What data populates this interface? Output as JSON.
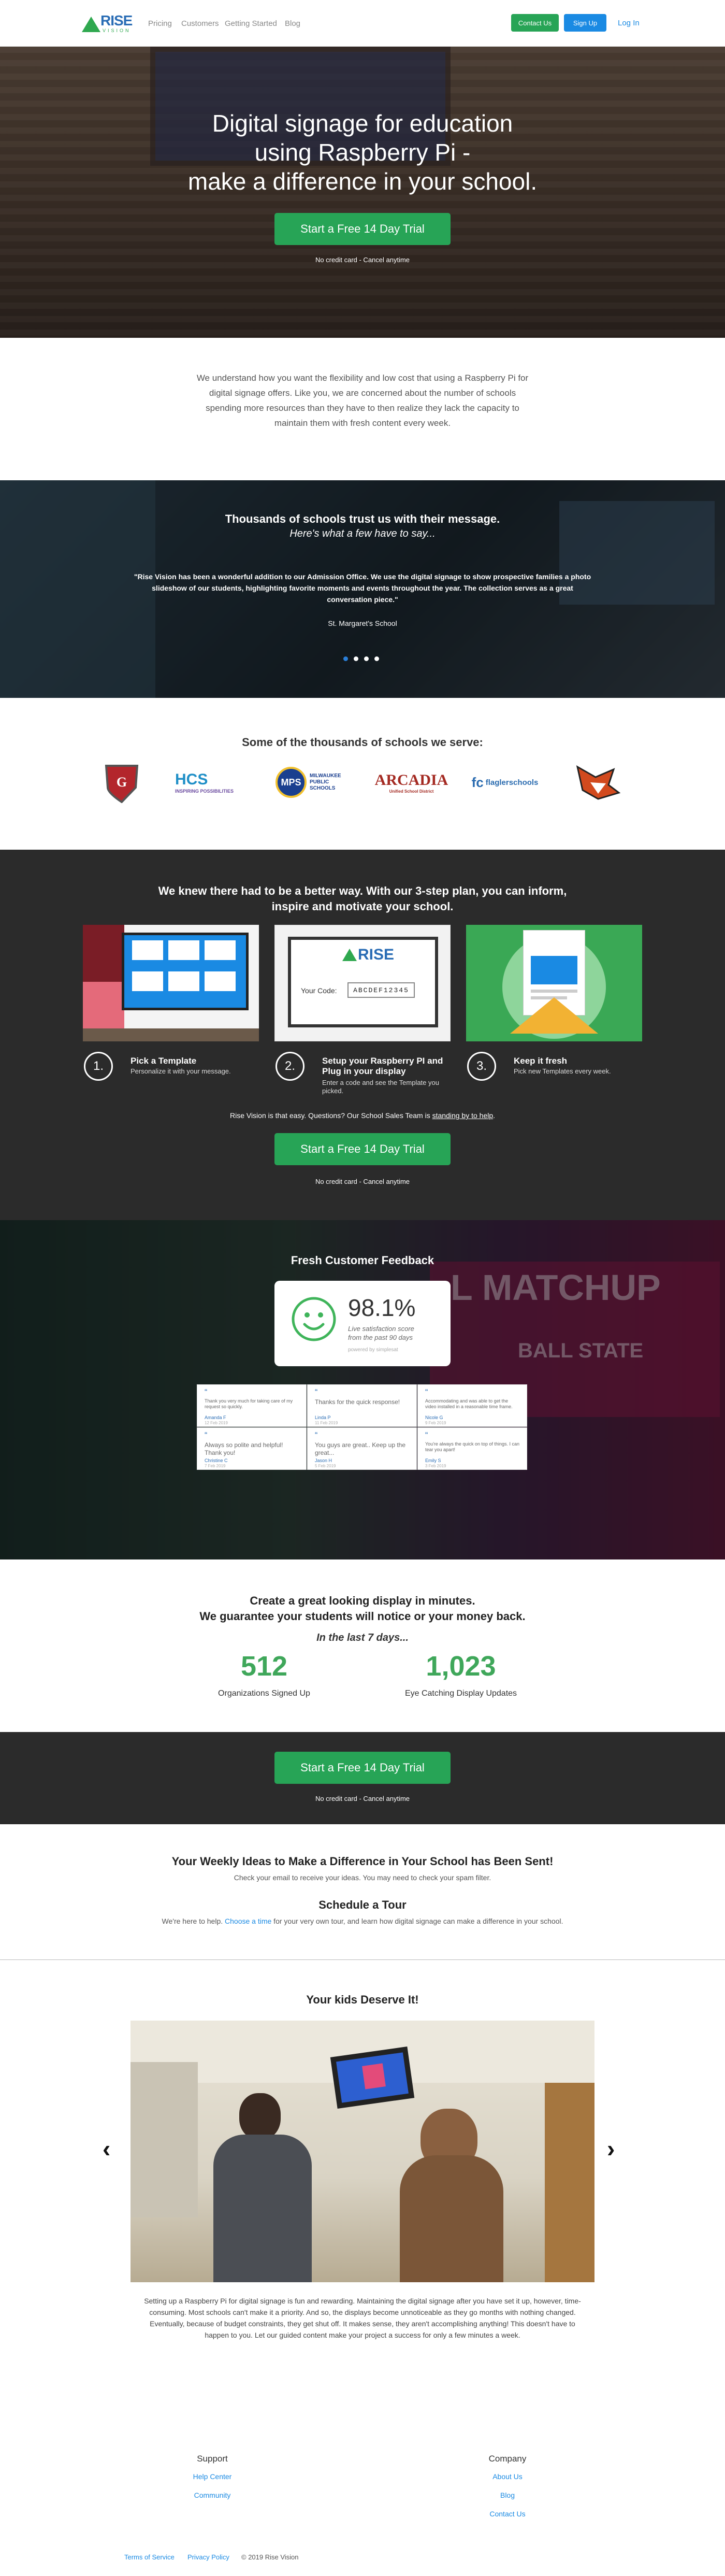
{
  "header": {
    "logo_text": "RISE",
    "logo_sub": "VISION",
    "nav": [
      "Pricing",
      "Customers",
      "Getting Started",
      "Blog"
    ],
    "contact_label": "Contact Us",
    "signup_label": "Sign Up",
    "login_label": "Log In"
  },
  "hero": {
    "title_line1": "Digital signage for education",
    "title_line2": "using Raspberry Pi -",
    "title_line3": "make a difference in your school.",
    "cta": "Start a Free 14 Day Trial",
    "note": "No credit card - Cancel anytime"
  },
  "intro": {
    "text": "We understand how you want the flexibility and low cost that using a Raspberry Pi for digital signage offers. Like you, we are concerned about the number of schools spending more resources than they have to then realize they lack the capacity to maintain them with fresh content every week."
  },
  "testimonials": {
    "heading": "Thousands of schools trust us with their message.",
    "subheading": "Here's what a few have to say...",
    "quote": "\"Rise Vision has been a wonderful addition to our Admission Office. We use the digital signage to show prospective families a photo slideshow of our students, highlighting favorite moments and events throughout the year. The collection serves as a great conversation piece.\"",
    "author": "St. Margaret's School"
  },
  "schools": {
    "heading": "Some of the thousands of schools we serve:",
    "logos": [
      {
        "text": "GT",
        "icon": "shield-crest-icon",
        "color": "#b3262c"
      },
      {
        "text": "HCS",
        "sub": "INSPIRING POSSIBILITIES",
        "color": "#1f8fc7"
      },
      {
        "text": "MPS",
        "sub": "MILWAUKEE PUBLIC SCHOOLS",
        "color": "#1a3f8f"
      },
      {
        "text": "ARCADIA",
        "sub": "Unified School District",
        "color": "#a42a22"
      },
      {
        "text": "fc",
        "sub": "flaglerschools",
        "color": "#2b6cb0"
      },
      {
        "text": "",
        "icon": "fox-mascot-icon",
        "color": "#d24a1e"
      }
    ]
  },
  "plan": {
    "heading_line1": "We knew there had to be a better way. With our 3-step plan, you can inform,",
    "heading_line2": "inspire and motivate your school.",
    "code_label": "Your Code:",
    "code_value": "ABCDEF12345",
    "steps": [
      {
        "num": "1.",
        "title": "Pick a Template",
        "desc": "Personalize it with your message."
      },
      {
        "num": "2.",
        "title": "Setup your Raspberry PI and Plug in your display",
        "desc": "Enter a code and see the Template you picked."
      },
      {
        "num": "3.",
        "title": "Keep it fresh",
        "desc": "Pick new Templates every week."
      }
    ],
    "note_prefix": "Rise Vision is that easy. Questions? Our School Sales Team is ",
    "note_link": "standing by to help",
    "note_suffix": ".",
    "cta": "Start a Free 14 Day Trial",
    "cta_note": "No credit card - Cancel anytime"
  },
  "feedback": {
    "heading": "Fresh Customer Feedback",
    "score": "98.1%",
    "score_caption1": "Live satisfaction score",
    "score_caption2": "from the past 90 days",
    "powered": "powered by simplesat",
    "cards": [
      {
        "text": "Thank you very much for taking care of my request so quickly.",
        "name": "Amanda F",
        "date": "12 Feb 2019"
      },
      {
        "text": "Thanks for the quick response!",
        "name": "Linda P",
        "date": "11 Feb 2019"
      },
      {
        "text": "Accommodating and was able to get the video installed in a reasonable time frame.",
        "name": "Nicole G",
        "date": "9 Feb 2019"
      },
      {
        "text": "Always so polite and helpful! Thank you!",
        "name": "Christine C",
        "date": "7 Feb 2019"
      },
      {
        "text": "You guys are great.. Keep up the great...",
        "name": "Jason H",
        "date": "5 Feb 2019"
      },
      {
        "text": "You're always the quick on top of things. I can tear you apart!",
        "name": "Emily S",
        "date": "3 Feb 2019"
      }
    ]
  },
  "stats": {
    "heading_line1": "Create a great looking display in minutes.",
    "heading_line2": "We guarantee your students will notice or your money back.",
    "period": "In the last 7 days...",
    "items": [
      {
        "value": "512",
        "label": "Organizations Signed Up"
      },
      {
        "value": "1,023",
        "label": "Eye Catching Display Updates"
      }
    ]
  },
  "cta_band": {
    "cta": "Start a Free 14 Day Trial",
    "note": "No credit card - Cancel anytime"
  },
  "ideas": {
    "heading": "Your Weekly Ideas to Make a Difference in Your School has Been Sent!",
    "sub": "Check your email to receive your ideas. You may need to check your spam filter.",
    "tour_heading": "Schedule a Tour",
    "tour_prefix": "We're here to help. ",
    "tour_link": "Choose a time",
    "tour_suffix": " for your very own tour, and learn how digital signage can make a difference in your school."
  },
  "kids": {
    "heading": "Your kids Deserve It!",
    "text": "Setting up a Raspberry Pi for digital signage is fun and rewarding. Maintaining the digital signage after you have set it up, however, time-consuming. Most schools can't make it a priority. And so, the displays become unnoticeable as they go months with nothing changed. Eventually, because of budget constraints, they get shut off. It makes sense, they aren't accomplishing anything! This doesn't have to happen to you. Let our guided content make your project a success for only a few minutes a week."
  },
  "footer": {
    "support_heading": "Support",
    "support_links": [
      "Help Center",
      "Community"
    ],
    "company_heading": "Company",
    "company_links": [
      "About Us",
      "Blog",
      "Contact Us"
    ],
    "terms": "Terms of Service",
    "privacy": "Privacy Policy",
    "copyright": "© 2019 Rise Vision"
  },
  "colors": {
    "green": "#27a456",
    "blue": "#1a8ae3",
    "dark": "#2b2b2b",
    "stat_green": "#3fa75a"
  }
}
